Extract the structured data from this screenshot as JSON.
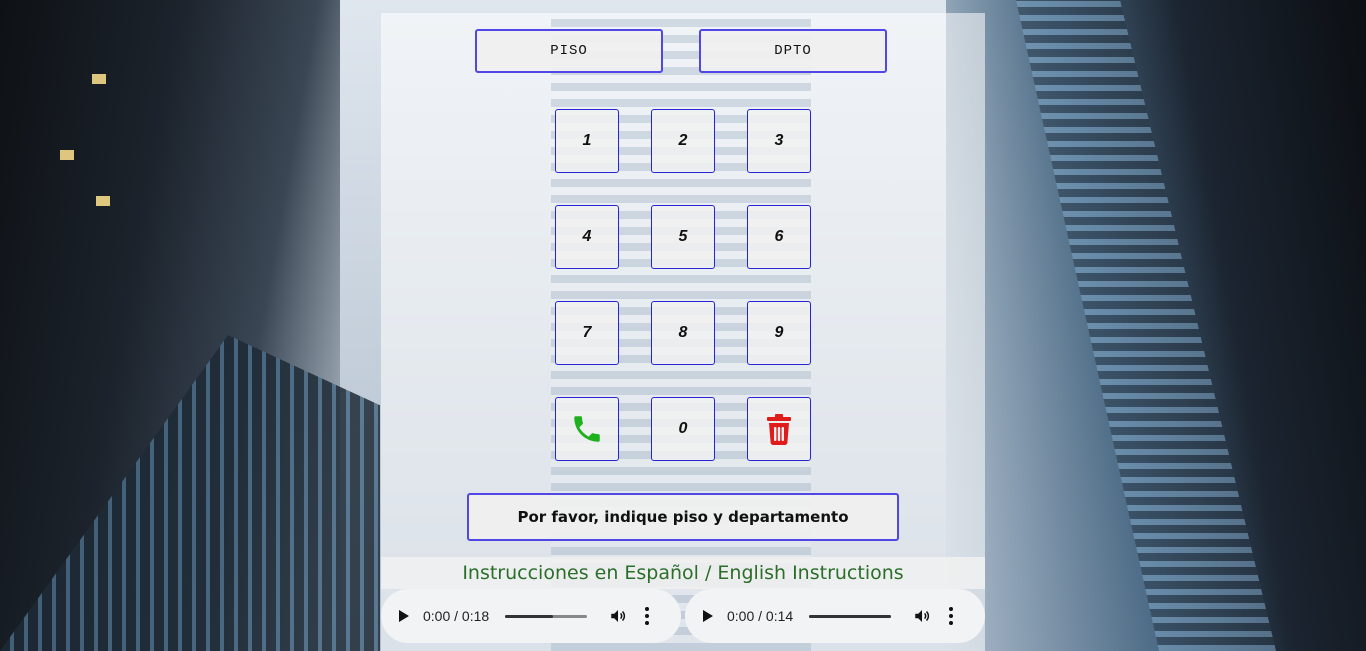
{
  "selector": {
    "floor_label": "PISO",
    "unit_label": "DPTO"
  },
  "keypad": {
    "keys": [
      "1",
      "2",
      "3",
      "4",
      "5",
      "6",
      "7",
      "8",
      "9",
      "0"
    ],
    "call_icon": "phone-icon",
    "delete_icon": "trash-icon",
    "colors": {
      "call": "#1db21d",
      "delete": "#e01b1b",
      "border": "#2723d6"
    }
  },
  "status": {
    "message": "Por favor, indique piso y departamento"
  },
  "instructions": {
    "title": "Instrucciones en Español / English Instructions",
    "color": "#2a6e2a"
  },
  "players": [
    {
      "time": "0:00 / 0:18",
      "progress": 0.58
    },
    {
      "time": "0:00 / 0:14",
      "progress": 1.0
    }
  ]
}
